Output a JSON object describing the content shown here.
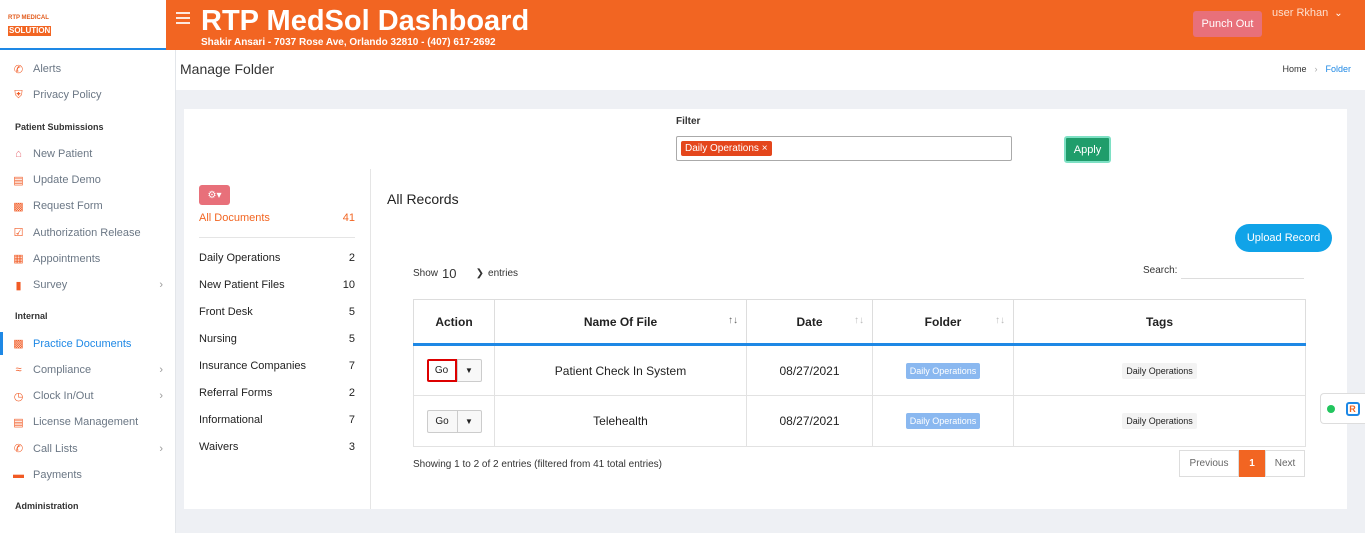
{
  "brand": {
    "logo_line1": "RTP MEDICAL",
    "logo_line2": "SOLUTION"
  },
  "header": {
    "title": "RTP MedSol Dashboard",
    "subtitle": "Shakir Ansari - 7037 Rose Ave, Orlando 32810 - (407) 617-2692",
    "punch_out": "Punch Out",
    "user_img_alt": "user",
    "user_name": "Rkhan"
  },
  "sidebar": {
    "items_top": [
      {
        "label": "Alerts",
        "icon": "phone-icon"
      },
      {
        "label": "Privacy Policy",
        "icon": "shield-icon"
      }
    ],
    "section_patient": "Patient Submissions",
    "items_patient": [
      {
        "label": "New Patient",
        "icon": "home-icon"
      },
      {
        "label": "Update Demo",
        "icon": "id-card-icon"
      },
      {
        "label": "Request Form",
        "icon": "file-icon"
      },
      {
        "label": "Authorization Release",
        "icon": "check-file-icon"
      },
      {
        "label": "Appointments",
        "icon": "calendar-icon"
      },
      {
        "label": "Survey",
        "icon": "chart-icon"
      }
    ],
    "section_internal": "Internal",
    "items_internal": [
      {
        "label": "Practice Documents",
        "icon": "document-icon"
      },
      {
        "label": "Compliance",
        "icon": "signature-icon"
      },
      {
        "label": "Clock In/Out",
        "icon": "clock-icon"
      },
      {
        "label": "License Management",
        "icon": "license-icon"
      },
      {
        "label": "Call Lists",
        "icon": "phone-icon"
      },
      {
        "label": "Payments",
        "icon": "money-icon"
      }
    ],
    "section_admin": "Administration"
  },
  "page": {
    "title": "Manage Folder",
    "breadcrumb_home": "Home",
    "breadcrumb_current": "Folder"
  },
  "filter": {
    "label": "Filter",
    "chip": "Daily Operations ×",
    "apply": "Apply"
  },
  "folders": {
    "all_label": "All Documents",
    "all_count": "41",
    "items": [
      {
        "name": "Daily Operations",
        "count": "2"
      },
      {
        "name": "New Patient Files",
        "count": "10"
      },
      {
        "name": "Front Desk",
        "count": "5"
      },
      {
        "name": "Nursing",
        "count": "5"
      },
      {
        "name": "Insurance Companies",
        "count": "7"
      },
      {
        "name": "Referral Forms",
        "count": "2"
      },
      {
        "name": "Informational",
        "count": "7"
      },
      {
        "name": "Waivers",
        "count": "3"
      }
    ]
  },
  "records": {
    "title": "All Records",
    "upload": "Upload Record",
    "show_label": "Show",
    "show_value": "10",
    "entries_label": "entries",
    "search_label": "Search:",
    "columns": [
      "Action",
      "Name Of File",
      "Date",
      "Folder",
      "Tags"
    ],
    "rows": [
      {
        "go": "Go",
        "name": "Patient Check In System",
        "date": "08/27/2021",
        "folder": "Daily Operations",
        "tag": "Daily Operations"
      },
      {
        "go": "Go",
        "name": "Telehealth",
        "date": "08/27/2021",
        "folder": "Daily Operations",
        "tag": "Daily Operations"
      }
    ],
    "showing": "Showing 1 to 2 of 2 entries (filtered from 41 total entries)",
    "pager": {
      "prev": "Previous",
      "page": "1",
      "next": "Next"
    }
  }
}
